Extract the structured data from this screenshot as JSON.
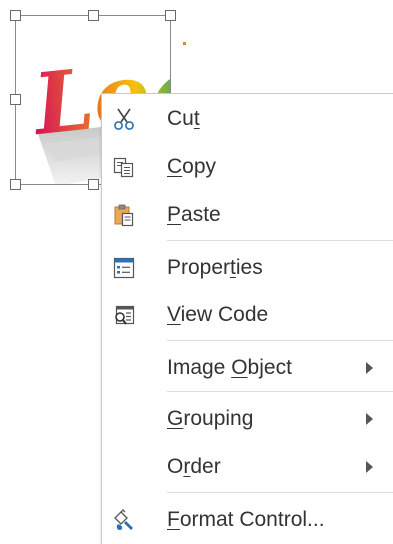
{
  "image_object": {
    "logo_text": "Logo"
  },
  "context_menu": {
    "items": [
      {
        "id": "cut",
        "pre": "Cu",
        "key": "t",
        "post": "",
        "icon": "scissors-icon",
        "submenu": false
      },
      {
        "id": "copy",
        "pre": "",
        "key": "C",
        "post": "opy",
        "icon": "copy-icon",
        "submenu": false
      },
      {
        "id": "paste",
        "pre": "",
        "key": "P",
        "post": "aste",
        "icon": "paste-icon",
        "submenu": false
      },
      {
        "id": "properties",
        "pre": "Proper",
        "key": "t",
        "post": "ies",
        "icon": "properties-icon",
        "submenu": false
      },
      {
        "id": "view-code",
        "pre": "",
        "key": "V",
        "post": "iew Code",
        "icon": "view-code-icon",
        "submenu": false
      },
      {
        "id": "image-object",
        "pre": "Image ",
        "key": "O",
        "post": "bject",
        "icon": null,
        "submenu": true
      },
      {
        "id": "grouping",
        "pre": "",
        "key": "G",
        "post": "rouping",
        "icon": null,
        "submenu": true
      },
      {
        "id": "order",
        "pre": "O",
        "key": "r",
        "post": "der",
        "icon": null,
        "submenu": true
      },
      {
        "id": "format-control",
        "pre": "",
        "key": "F",
        "post": "ormat Control...",
        "icon": "format-control-icon",
        "submenu": false
      }
    ]
  },
  "colors": {
    "menu_text": "#333333",
    "separator": "#dedede",
    "icon_blue": "#2f6fb5",
    "icon_orange": "#d9822b"
  }
}
